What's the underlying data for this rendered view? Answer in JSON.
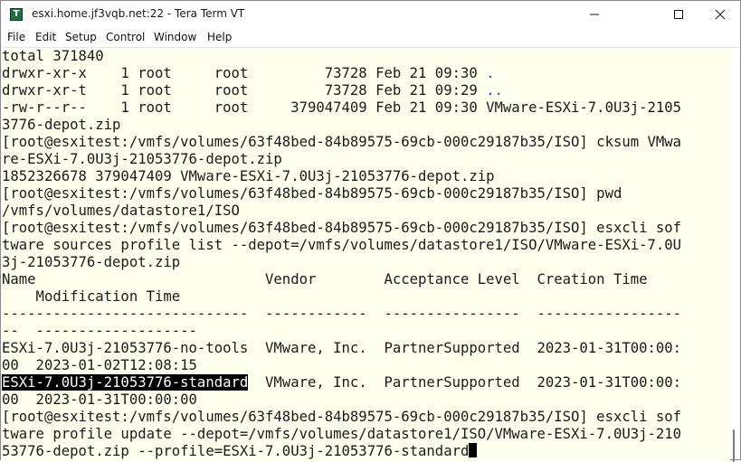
{
  "window": {
    "title": "esxi.home.jf3vqb.net:22 - Tera Term VT",
    "icon": "teraterm-icon",
    "icon_glyph": "T",
    "controls": {
      "minimize": "minimize-icon",
      "maximize": "maximize-icon",
      "close": "close-icon"
    }
  },
  "menu": {
    "items": [
      "File",
      "Edit",
      "Setup",
      "Control",
      "Window",
      "Help"
    ]
  },
  "terminal": {
    "background": "#ffffee",
    "lines": [
      {
        "text": "total 371840"
      },
      {
        "text": "drwxr-xr-x    1 root     root         73728 Feb 21 09:30 ",
        "link": "."
      },
      {
        "text": "drwxr-xr-t    1 root     root         73728 Feb 21 09:29 ",
        "link": ".."
      },
      {
        "text": "-rw-r--r--    1 root     root     379047409 Feb 21 09:30 VMware-ESXi-7.0U3j-2105"
      },
      {
        "text": "3776-depot.zip"
      },
      {
        "text": "[root@esxitest:/vmfs/volumes/63f48bed-84b89575-69cb-000c29187b35/ISO] cksum VMwa"
      },
      {
        "text": "re-ESXi-7.0U3j-21053776-depot.zip"
      },
      {
        "text": "1852326678 379047409 VMware-ESXi-7.0U3j-21053776-depot.zip"
      },
      {
        "text": "[root@esxitest:/vmfs/volumes/63f48bed-84b89575-69cb-000c29187b35/ISO] pwd"
      },
      {
        "text": "/vmfs/volumes/datastore1/ISO"
      },
      {
        "text": "[root@esxitest:/vmfs/volumes/63f48bed-84b89575-69cb-000c29187b35/ISO] esxcli sof"
      },
      {
        "text": "tware sources profile list --depot=/vmfs/volumes/datastore1/ISO/VMware-ESXi-7.0U"
      },
      {
        "text": "3j-21053776-depot.zip"
      },
      {
        "text": "Name                           Vendor        Acceptance Level  Creation Time"
      },
      {
        "text": "    Modification Time"
      },
      {
        "text": "-----------------------------  ------------  ----------------  -----------------"
      },
      {
        "text": "--  -------------------"
      },
      {
        "text": "ESXi-7.0U3j-21053776-no-tools  VMware, Inc.  PartnerSupported  2023-01-31T00:00:"
      },
      {
        "text": "00  2023-01-02T12:08:15"
      },
      {
        "highlight": "ESXi-7.0U3j-21053776-standard",
        "text": "  VMware, Inc.  PartnerSupported  2023-01-31T00:00:"
      },
      {
        "text": "00  2023-01-31T00:00:00"
      },
      {
        "text": "[root@esxitest:/vmfs/volumes/63f48bed-84b89575-69cb-000c29187b35/ISO] esxcli sof"
      },
      {
        "text": "tware profile update --depot=/vmfs/volumes/datastore1/ISO/VMware-ESXi-7.0U3j-210"
      },
      {
        "text": "53776-depot.zip --profile=ESXi-7.0U3j-21053776-standard",
        "cursor": true
      }
    ]
  }
}
